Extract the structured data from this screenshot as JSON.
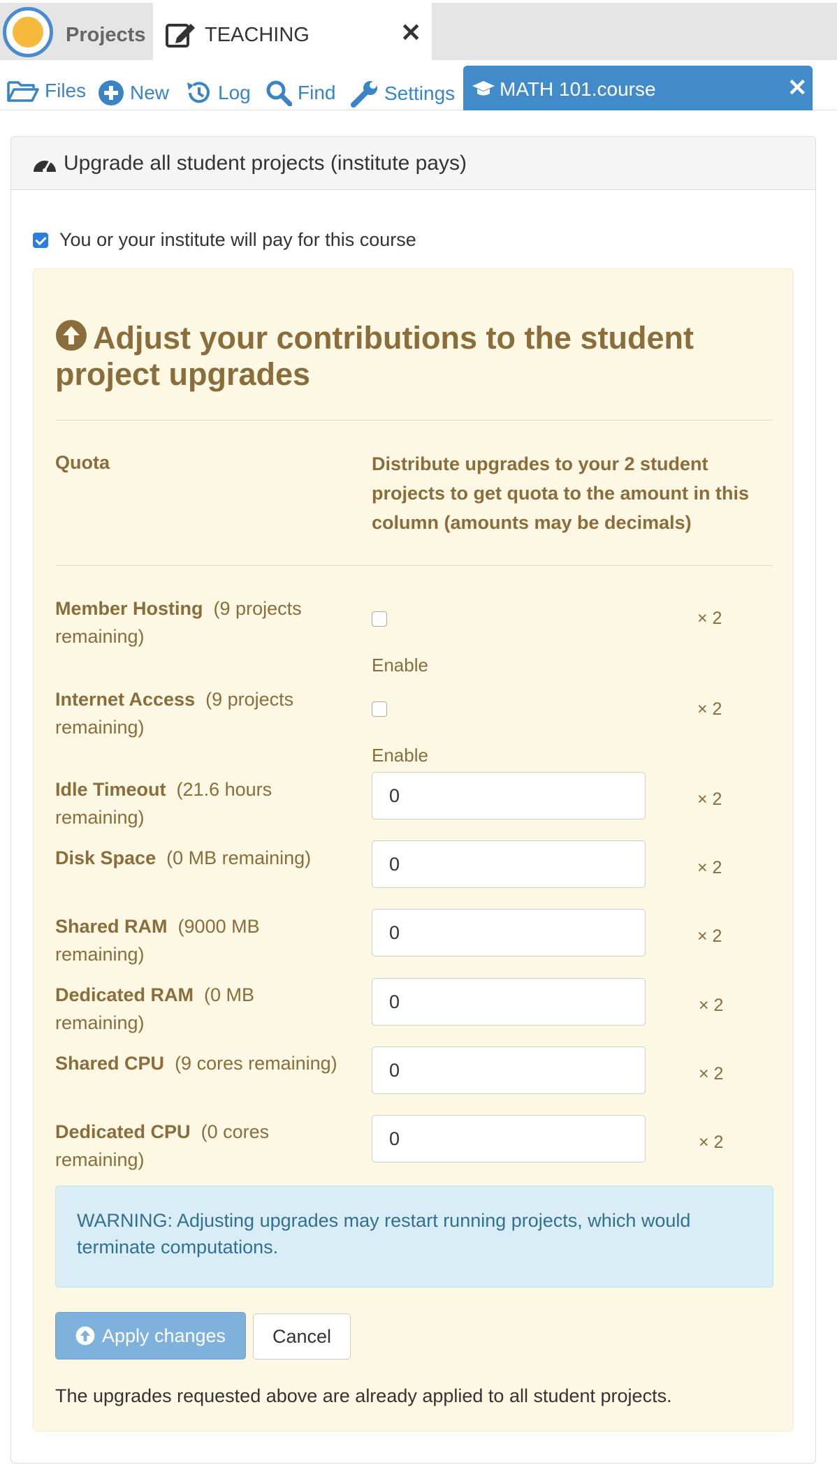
{
  "top_tabs": {
    "projects_label": "Projects",
    "active_project_label": "TEACHING",
    "close_glyph": "✕"
  },
  "nav": {
    "files": "Files",
    "new": "New",
    "log": "Log",
    "find": "Find",
    "settings": "Settings",
    "course_tab": "MATH 101.course",
    "course_close": "✕"
  },
  "panel": {
    "title": "Upgrade all student projects (institute pays)",
    "pay_checkbox_label": "You or your institute will pay for this course",
    "pay_checked": true
  },
  "contributions": {
    "title": "Adjust your contributions to the student project upgrades",
    "quota_header": "Quota",
    "distribute_header": "Distribute upgrades to your 2 student projects to get quota to the amount in this column (amounts may be decimals)",
    "rows": [
      {
        "name": "Member Hosting",
        "remaining": "(9 projects remaining)",
        "type": "checkbox",
        "enable_label": "Enable",
        "multiplier": "× 2"
      },
      {
        "name": "Internet Access",
        "remaining": "(9 projects remaining)",
        "type": "checkbox",
        "enable_label": "Enable",
        "multiplier": "× 2"
      },
      {
        "name": "Idle Timeout",
        "remaining": "(21.6 hours remaining)",
        "type": "number",
        "value": "0",
        "multiplier": "× 2"
      },
      {
        "name": "Disk Space",
        "remaining": "(0 MB remaining)",
        "type": "number",
        "value": "0",
        "multiplier": "× 2"
      },
      {
        "name": "Shared RAM",
        "remaining": "(9000 MB remaining)",
        "type": "number",
        "value": "0",
        "multiplier": "× 2"
      },
      {
        "name": "Dedicated RAM",
        "remaining": "(0 MB remaining)",
        "type": "number",
        "value": "0",
        "multiplier": "× 2"
      },
      {
        "name": "Shared CPU",
        "remaining": "(9 cores remaining)",
        "type": "number",
        "value": "0",
        "multiplier": "× 2"
      },
      {
        "name": "Dedicated CPU",
        "remaining": "(0 cores remaining)",
        "type": "number",
        "value": "0",
        "multiplier": "× 2"
      }
    ],
    "warning": "WARNING: Adjusting upgrades may restart running projects, which would terminate computations.",
    "apply_label": "Apply changes",
    "cancel_label": "Cancel",
    "applied_note": "The upgrades requested above are already applied to all student projects."
  },
  "colors": {
    "accent": "#428bca",
    "warning_text": "#8a6d3b",
    "warning_bg": "#fcf8e3",
    "info_bg": "#d9edf7",
    "info_text": "#31708f"
  }
}
